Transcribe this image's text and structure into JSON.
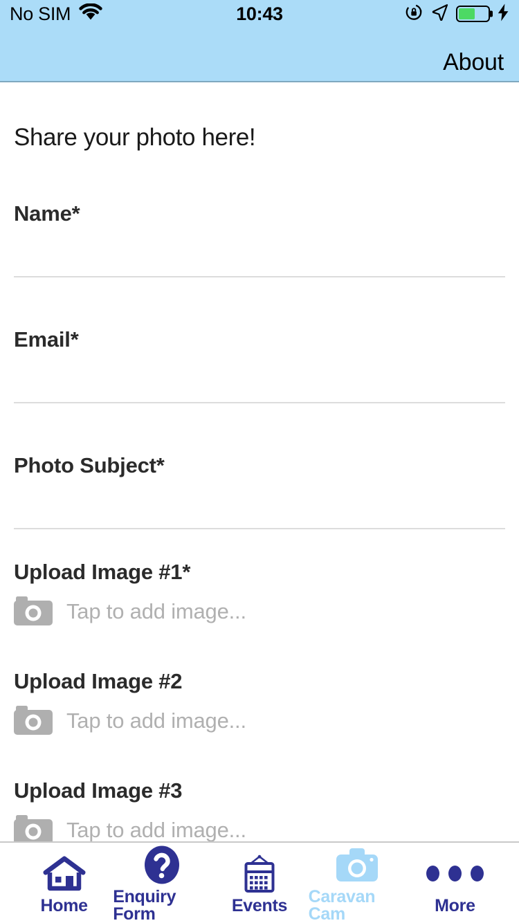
{
  "status_bar": {
    "carrier": "No SIM",
    "time": "10:43",
    "icons": {
      "wifi": "wifi-icon",
      "rotation_lock": "rotation-lock-icon",
      "location": "location-arrow-icon",
      "battery": "battery-icon",
      "charging": "lightning-bolt-icon"
    },
    "battery_percent": 55
  },
  "nav_bar": {
    "about_label": "About"
  },
  "form": {
    "title": "Share your photo here!",
    "fields": [
      {
        "label": "Name*",
        "value": "",
        "placeholder": ""
      },
      {
        "label": "Email*",
        "value": "",
        "placeholder": ""
      },
      {
        "label": "Photo Subject*",
        "value": "",
        "placeholder": ""
      }
    ],
    "uploads": [
      {
        "label": "Upload Image #1*",
        "placeholder": "Tap to add image...",
        "icon": "camera-icon"
      },
      {
        "label": "Upload Image #2",
        "placeholder": "Tap to add image...",
        "icon": "camera-icon"
      },
      {
        "label": "Upload Image #3",
        "placeholder": "Tap to add image...",
        "icon": "camera-icon"
      }
    ]
  },
  "tab_bar": {
    "items": [
      {
        "label": "Home",
        "icon": "home-icon",
        "active": false
      },
      {
        "label": "Enquiry Form",
        "icon": "question-mark-circle-icon",
        "active": false
      },
      {
        "label": "Events",
        "icon": "calendar-icon",
        "active": false
      },
      {
        "label": "Caravan Cam",
        "icon": "camera-icon",
        "active": true
      },
      {
        "label": "More",
        "icon": "ellipsis-icon",
        "active": false
      }
    ]
  },
  "colors": {
    "nav_bar_blue": "#ABDCF8",
    "tab_navy": "#2E3192",
    "tab_active_blue": "#A5D8F8",
    "placeholder_gray": "#B0B0B0",
    "divider_gray": "#DCDCDC",
    "battery_green": "#4CD964"
  }
}
